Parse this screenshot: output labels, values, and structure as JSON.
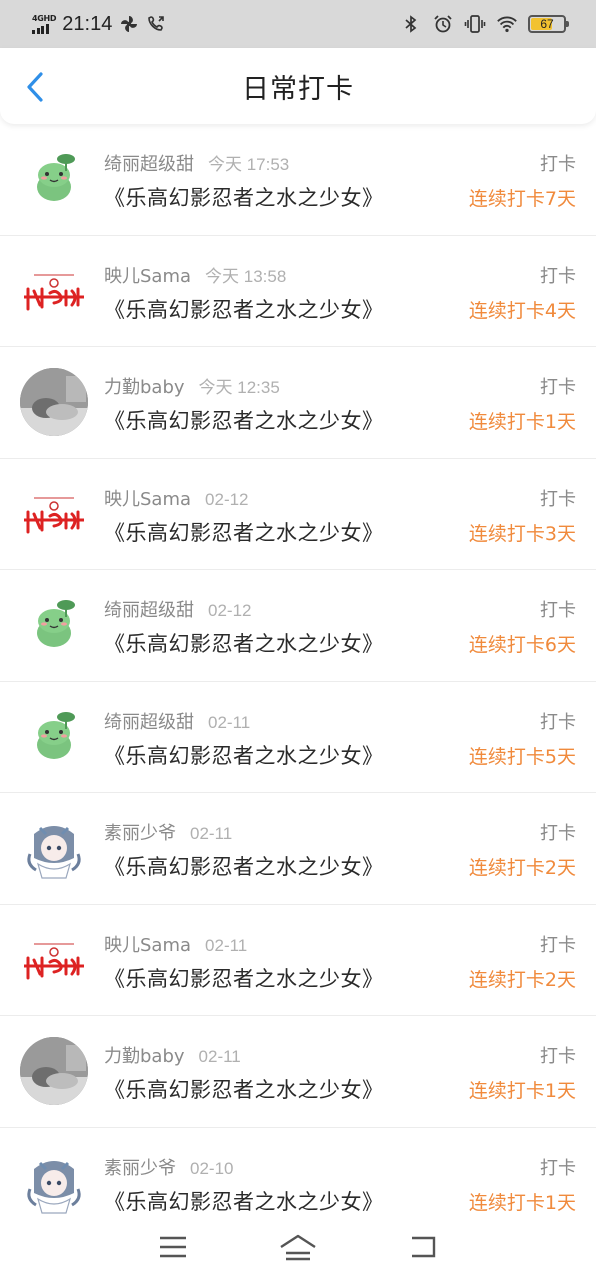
{
  "status_bar": {
    "network": "4GHD",
    "time": "21:14",
    "battery": "67",
    "battery_level": 0.67,
    "icons": [
      "sync-icon",
      "wifi-call-icon",
      "bluetooth-icon",
      "alarm-icon",
      "vibrate-icon",
      "wifi-icon",
      "battery-icon"
    ]
  },
  "header": {
    "title": "日常打卡",
    "back_icon": "chevron-left-icon"
  },
  "colors": {
    "accent_blue": "#2f8fe8",
    "streak_orange": "#f08a3c",
    "status_bar_bg": "#d9d9d9"
  },
  "items": [
    {
      "user": "绮丽超级甜",
      "time": "今天 17:53",
      "book": "《乐高幻影忍者之水之少女》",
      "label": "打卡",
      "streak": "连续打卡7天",
      "avatar": "frog"
    },
    {
      "user": "映儿Sama",
      "time": "今天 13:58",
      "book": "《乐高幻影忍者之水之少女》",
      "label": "打卡",
      "streak": "连续打卡4天",
      "avatar": "sign"
    },
    {
      "user": "力勤baby",
      "time": "今天 12:35",
      "book": "《乐高幻影忍者之水之少女》",
      "label": "打卡",
      "streak": "连续打卡1天",
      "avatar": "baby"
    },
    {
      "user": "映儿Sama",
      "time": "02-12",
      "book": "《乐高幻影忍者之水之少女》",
      "label": "打卡",
      "streak": "连续打卡3天",
      "avatar": "sign"
    },
    {
      "user": "绮丽超级甜",
      "time": "02-12",
      "book": "《乐高幻影忍者之水之少女》",
      "label": "打卡",
      "streak": "连续打卡6天",
      "avatar": "frog"
    },
    {
      "user": "绮丽超级甜",
      "time": "02-11",
      "book": "《乐高幻影忍者之水之少女》",
      "label": "打卡",
      "streak": "连续打卡5天",
      "avatar": "frog"
    },
    {
      "user": "素丽少爷",
      "time": "02-11",
      "book": "《乐高幻影忍者之水之少女》",
      "label": "打卡",
      "streak": "连续打卡2天",
      "avatar": "anime"
    },
    {
      "user": "映儿Sama",
      "time": "02-11",
      "book": "《乐高幻影忍者之水之少女》",
      "label": "打卡",
      "streak": "连续打卡2天",
      "avatar": "sign"
    },
    {
      "user": "力勤baby",
      "time": "02-11",
      "book": "《乐高幻影忍者之水之少女》",
      "label": "打卡",
      "streak": "连续打卡1天",
      "avatar": "baby"
    },
    {
      "user": "素丽少爷",
      "time": "02-10",
      "book": "《乐高幻影忍者之水之少女》",
      "label": "打卡",
      "streak": "连续打卡1天",
      "avatar": "anime"
    }
  ],
  "system_nav": {
    "icons": [
      "menu-icon",
      "home-icon",
      "back-icon"
    ]
  }
}
